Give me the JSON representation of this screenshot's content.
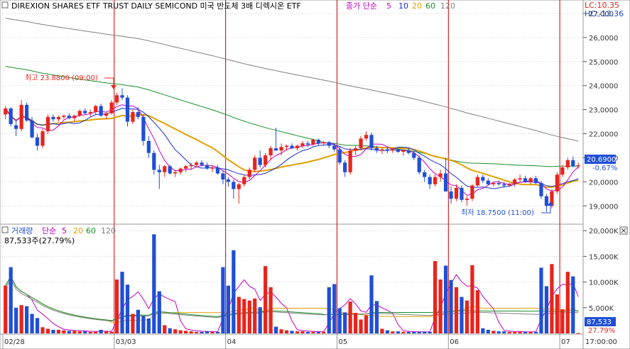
{
  "instrument_name": "DIREXION SHARES ETF TRUST DAILY SEMICOND  미국 반도체 3배 디렉시온 ETF",
  "price_panel": {
    "legend_label": "종가 단순",
    "ma_periods": [
      "5",
      "10",
      "20",
      "60",
      "120"
    ],
    "lc_label": "LC:10.35",
    "hc_label": "HC:-13.36",
    "high_annotation": "최고 23.8800 (09:00)",
    "low_annotation": "최저 18.7500 (11:00)",
    "current_price_box": "20.6900",
    "current_change": "-0.67%"
  },
  "volume_panel": {
    "legend_label": "거래량",
    "legend_ma_label": "단순",
    "ma_periods": [
      "5",
      "20",
      "60",
      "120"
    ],
    "current_volume_text": "87,533주(27.79%)",
    "current_volume_box": "87,533",
    "current_ratio": "27.79%"
  },
  "colors": {
    "up": "#e8241c",
    "down": "#1f4fd6",
    "ma5": "#1a2fd0",
    "ma10": "#e0a000",
    "ma20": "#1a8f2a",
    "ma60": "#808080",
    "ma120": "#c000c0",
    "session_line": "#d00000",
    "price_box": "#1f4fd6",
    "volume_box": "#1f4fd6"
  },
  "chart_data": [
    {
      "type": "candlestick",
      "panel": "price",
      "ylim": [
        18300,
        27500
      ],
      "y_ticks": [
        "27,000",
        "26,0000",
        "25,0000",
        "24,0000",
        "23,0000",
        "22,0000",
        "21,0000",
        "20,0000",
        "19,0000"
      ],
      "y_tick_values": [
        27000,
        26000,
        25000,
        24000,
        23000,
        22000,
        21000,
        20000,
        19000
      ],
      "x_session_labels": [
        "02/28",
        "03/03",
        "04",
        "05",
        "06",
        "07",
        "17:00:00"
      ],
      "high_value": 23880,
      "low_value": 18750,
      "close_value": 20690,
      "candles": [
        [
          22800,
          23150,
          22600,
          23050
        ],
        [
          23050,
          23100,
          22300,
          22400
        ],
        [
          22350,
          22600,
          21900,
          22200
        ],
        [
          22200,
          23400,
          22100,
          23200
        ],
        [
          23200,
          23300,
          22500,
          22550
        ],
        [
          22550,
          22700,
          21800,
          21850
        ],
        [
          21850,
          22000,
          21300,
          21500
        ],
        [
          21500,
          22200,
          21400,
          22100
        ],
        [
          22100,
          22800,
          22000,
          22700
        ],
        [
          22700,
          22800,
          22500,
          22600
        ],
        [
          22600,
          22750,
          22500,
          22700
        ],
        [
          22700,
          22800,
          22600,
          22750
        ],
        [
          22750,
          22850,
          22600,
          22650
        ],
        [
          22650,
          22800,
          22500,
          22750
        ],
        [
          22750,
          23000,
          22700,
          22950
        ],
        [
          22950,
          23050,
          22800,
          22850
        ],
        [
          22850,
          23000,
          22700,
          22900
        ],
        [
          22900,
          23200,
          22800,
          23150
        ],
        [
          23150,
          23250,
          22700,
          22750
        ],
        [
          22750,
          22900,
          22600,
          22850
        ],
        [
          22850,
          23400,
          22800,
          23300
        ],
        [
          23300,
          23700,
          23200,
          23600
        ],
        [
          23600,
          23880,
          23400,
          23500
        ],
        [
          23500,
          23600,
          22300,
          22500
        ],
        [
          22500,
          23000,
          22400,
          22900
        ],
        [
          22900,
          23100,
          22600,
          22700
        ],
        [
          22700,
          22800,
          21500,
          21700
        ],
        [
          21700,
          21900,
          21000,
          21200
        ],
        [
          21200,
          21300,
          20300,
          20500
        ],
        [
          20500,
          20700,
          19700,
          20400
        ],
        [
          20400,
          20700,
          20200,
          20650
        ],
        [
          20650,
          20700,
          20300,
          20350
        ],
        [
          20350,
          20500,
          20200,
          20400
        ],
        [
          20400,
          20600,
          20300,
          20550
        ],
        [
          20550,
          20700,
          20400,
          20650
        ],
        [
          20650,
          20800,
          20500,
          20700
        ],
        [
          20700,
          20850,
          20600,
          20800
        ],
        [
          20800,
          20900,
          20650,
          20700
        ],
        [
          20700,
          20800,
          20500,
          20550
        ],
        [
          20550,
          20700,
          20400,
          20600
        ],
        [
          20600,
          20700,
          20300,
          20350
        ],
        [
          20350,
          20450,
          19900,
          20100
        ],
        [
          20100,
          20200,
          19800,
          20000
        ],
        [
          20000,
          20100,
          19300,
          19700
        ],
        [
          19700,
          19950,
          19100,
          19900
        ],
        [
          19900,
          20300,
          19800,
          20200
        ],
        [
          20200,
          20600,
          20100,
          20500
        ],
        [
          20500,
          21100,
          20400,
          21000
        ],
        [
          21000,
          21300,
          20600,
          20700
        ],
        [
          20700,
          21200,
          20600,
          21100
        ],
        [
          21100,
          21500,
          20900,
          21400
        ],
        [
          21400,
          22250,
          21300,
          21300
        ],
        [
          21300,
          21600,
          21100,
          21450
        ],
        [
          21450,
          21550,
          21300,
          21500
        ],
        [
          21500,
          21600,
          21350,
          21400
        ],
        [
          21400,
          21550,
          21300,
          21500
        ],
        [
          21500,
          21700,
          21400,
          21600
        ],
        [
          21600,
          21700,
          21450,
          21550
        ],
        [
          21550,
          21800,
          21500,
          21750
        ],
        [
          21750,
          21800,
          21500,
          21600
        ],
        [
          21600,
          21700,
          21500,
          21650
        ],
        [
          21650,
          21700,
          21400,
          21500
        ],
        [
          21500,
          21600,
          21250,
          21350
        ],
        [
          21350,
          21450,
          20700,
          20800
        ],
        [
          20800,
          20900,
          20200,
          20400
        ],
        [
          20400,
          21400,
          20300,
          21300
        ],
        [
          21300,
          21500,
          21100,
          21400
        ],
        [
          21400,
          21900,
          21300,
          21800
        ],
        [
          21800,
          22100,
          21700,
          21950
        ],
        [
          21950,
          22050,
          21300,
          21400
        ],
        [
          21400,
          21500,
          21200,
          21300
        ],
        [
          21300,
          21400,
          21150,
          21350
        ],
        [
          21350,
          21450,
          21200,
          21300
        ],
        [
          21300,
          21400,
          21200,
          21350
        ],
        [
          21350,
          21400,
          21200,
          21250
        ],
        [
          21250,
          21350,
          21100,
          21300
        ],
        [
          21300,
          21400,
          21150,
          21200
        ],
        [
          21200,
          21300,
          20900,
          21000
        ],
        [
          21000,
          21100,
          20300,
          20400
        ],
        [
          20400,
          20500,
          20000,
          20200
        ],
        [
          20200,
          20300,
          19700,
          19900
        ],
        [
          19900,
          20300,
          19800,
          20200
        ],
        [
          20200,
          20500,
          20000,
          20350
        ],
        [
          20350,
          21000,
          20300,
          19600
        ],
        [
          19600,
          19800,
          19100,
          19300
        ],
        [
          19300,
          19900,
          19200,
          19750
        ],
        [
          19750,
          19850,
          19150,
          19250
        ],
        [
          19250,
          19400,
          19000,
          19300
        ],
        [
          19300,
          19900,
          19200,
          19850
        ],
        [
          19850,
          20300,
          19800,
          20200
        ],
        [
          20200,
          20300,
          19950,
          20050
        ],
        [
          20050,
          20150,
          19850,
          19900
        ],
        [
          19900,
          20000,
          19800,
          19950
        ],
        [
          19950,
          20050,
          19850,
          19900
        ],
        [
          19900,
          20000,
          19750,
          19850
        ],
        [
          19850,
          19950,
          19800,
          19900
        ],
        [
          19900,
          20150,
          19800,
          20100
        ],
        [
          20100,
          20300,
          20000,
          20150
        ],
        [
          20150,
          20250,
          19950,
          20000
        ],
        [
          20000,
          20200,
          19900,
          20150
        ],
        [
          20150,
          20250,
          19900,
          19950
        ],
        [
          19950,
          20050,
          19300,
          19400
        ],
        [
          19400,
          19500,
          18750,
          19000
        ],
        [
          19000,
          19700,
          18900,
          19600
        ],
        [
          19600,
          20400,
          19500,
          20300
        ],
        [
          20300,
          20700,
          20200,
          20600
        ],
        [
          20600,
          21000,
          20500,
          20900
        ],
        [
          20900,
          21050,
          20600,
          20650
        ],
        [
          20650,
          20800,
          20550,
          20690
        ]
      ]
    },
    {
      "type": "bar",
      "panel": "volume",
      "ylim": [
        0,
        21000
      ],
      "y_ticks": [
        "20,000K",
        "15,000K",
        "10,000K",
        "5,000K"
      ],
      "y_tick_values": [
        20000,
        15000,
        10000,
        5000
      ],
      "values": [
        9300,
        12900,
        5000,
        5500,
        5300,
        3800,
        3000,
        1200,
        900,
        700,
        700,
        600,
        500,
        500,
        400,
        400,
        300,
        300,
        700,
        400,
        300,
        10500,
        12000,
        9500,
        3800,
        4600,
        3400,
        2900,
        19300,
        8200,
        1600,
        1000,
        800,
        600,
        500,
        400,
        300,
        300,
        400,
        300,
        300,
        12900,
        9300,
        16200,
        7100,
        6700,
        6400,
        6800,
        5100,
        13100,
        9000,
        1300,
        800,
        600,
        500,
        400,
        400,
        300,
        300,
        300,
        300,
        9000,
        9600,
        4900,
        4100,
        6200,
        4000,
        2700,
        3500,
        11300,
        6300,
        900,
        600,
        400,
        400,
        300,
        300,
        300,
        300,
        300,
        300,
        14100,
        10500,
        13200,
        10400,
        9000,
        7100,
        6400,
        13300,
        8400,
        1000,
        700,
        500,
        400,
        400,
        300,
        300,
        300,
        300,
        300,
        300,
        12800,
        9200,
        13500,
        7600,
        4700,
        12000,
        11100,
        87.533
      ]
    }
  ]
}
